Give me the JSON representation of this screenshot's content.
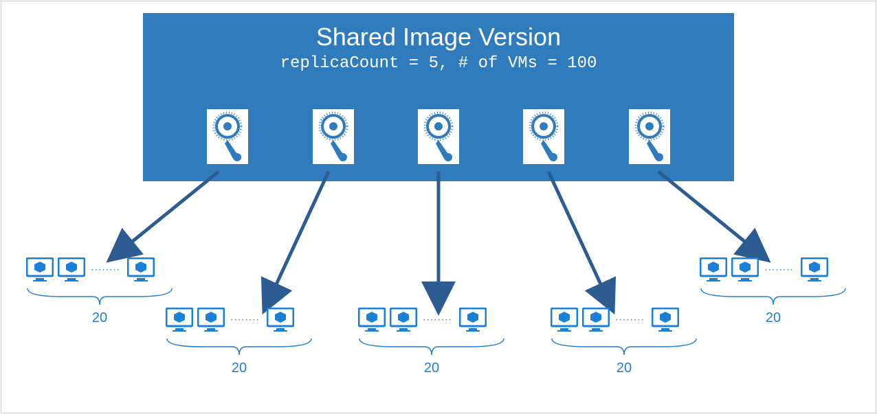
{
  "header": {
    "title": "Shared Image Version",
    "subtitle": "replicaCount = 5, # of VMs = 100"
  },
  "ellipsis": "········",
  "groups": [
    {
      "count": "20"
    },
    {
      "count": "20"
    },
    {
      "count": "20"
    },
    {
      "count": "20"
    },
    {
      "count": "20"
    }
  ],
  "colors": {
    "headerBg": "#2f7bbb",
    "accent": "#1b7fd6",
    "arrow": "#2c5c92"
  }
}
